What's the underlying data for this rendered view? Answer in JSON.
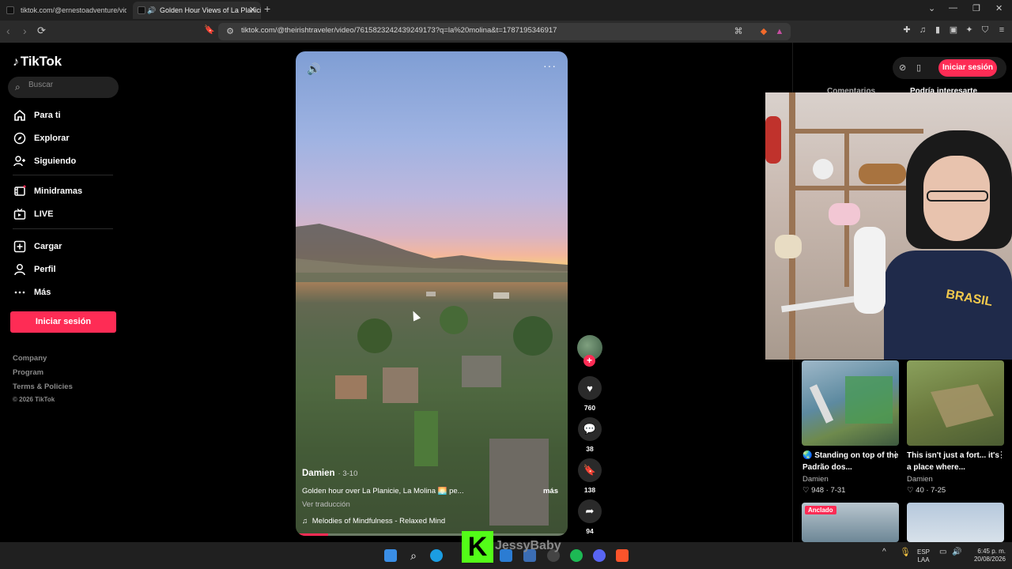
{
  "browser": {
    "tabs": [
      {
        "title": "tiktok.com/@ernestoadventure/video"
      },
      {
        "title": "Golden Hour Views of La Planicie"
      }
    ],
    "new_tab": "+",
    "url": "tiktok.com/@theirishtraveler/video/7615823242439249173?q=la%20molina&t=1787195346917"
  },
  "sidebar": {
    "logo": "TikTok",
    "search_placeholder": "Buscar",
    "nav": [
      {
        "label": "Para ti",
        "icon": "home-icon"
      },
      {
        "label": "Explorar",
        "icon": "compass-icon"
      },
      {
        "label": "Siguiendo",
        "icon": "following-icon"
      },
      {
        "label": "Minidramas",
        "icon": "minidramas-icon"
      },
      {
        "label": "LIVE",
        "icon": "live-icon"
      },
      {
        "label": "Cargar",
        "icon": "upload-icon"
      },
      {
        "label": "Perfil",
        "icon": "profile-icon"
      },
      {
        "label": "Más",
        "icon": "more-icon"
      }
    ],
    "login_label": "Iniciar sesión",
    "footer": [
      "Company",
      "Program",
      "Terms & Policies"
    ],
    "copyright": "© 2026 TikTok"
  },
  "video": {
    "author": "Damien",
    "date": "· 3-10",
    "caption": "Golden hour over La Planicie, La Molina 🌅 pe...",
    "more": "más",
    "translate": "Ver traducción",
    "music": "Melodies of Mindfulness - Relaxed Mind",
    "progress": 0.12,
    "actions": {
      "likes": "760",
      "comments": "38",
      "saves": "138",
      "shares": "94"
    }
  },
  "right_panel": {
    "login_label": "Iniciar sesión",
    "tabs": [
      "Comentarios",
      "Podría interesarte"
    ],
    "cards": [
      {
        "title": "🌏 Standing on top of the Padrão dos...",
        "author": "Damien",
        "stats": "♡ 948 · 7-31"
      },
      {
        "title": "This isn't just a fort... it's a place where...",
        "author": "Damien",
        "stats": "♡ 40 · 7-25"
      }
    ],
    "pinned_label": "Anclado"
  },
  "overlay": {
    "kick_letter": "K",
    "streamer_name": "JessyBaby",
    "shirt_text": "BRASIL"
  },
  "taskbar": {
    "lang": "ESP",
    "lang2": "LAA",
    "time": "6:45 p. m.",
    "date": "20/08/2026"
  },
  "colors": {
    "accent": "#fe2c55",
    "kick_green": "#53fc18"
  }
}
